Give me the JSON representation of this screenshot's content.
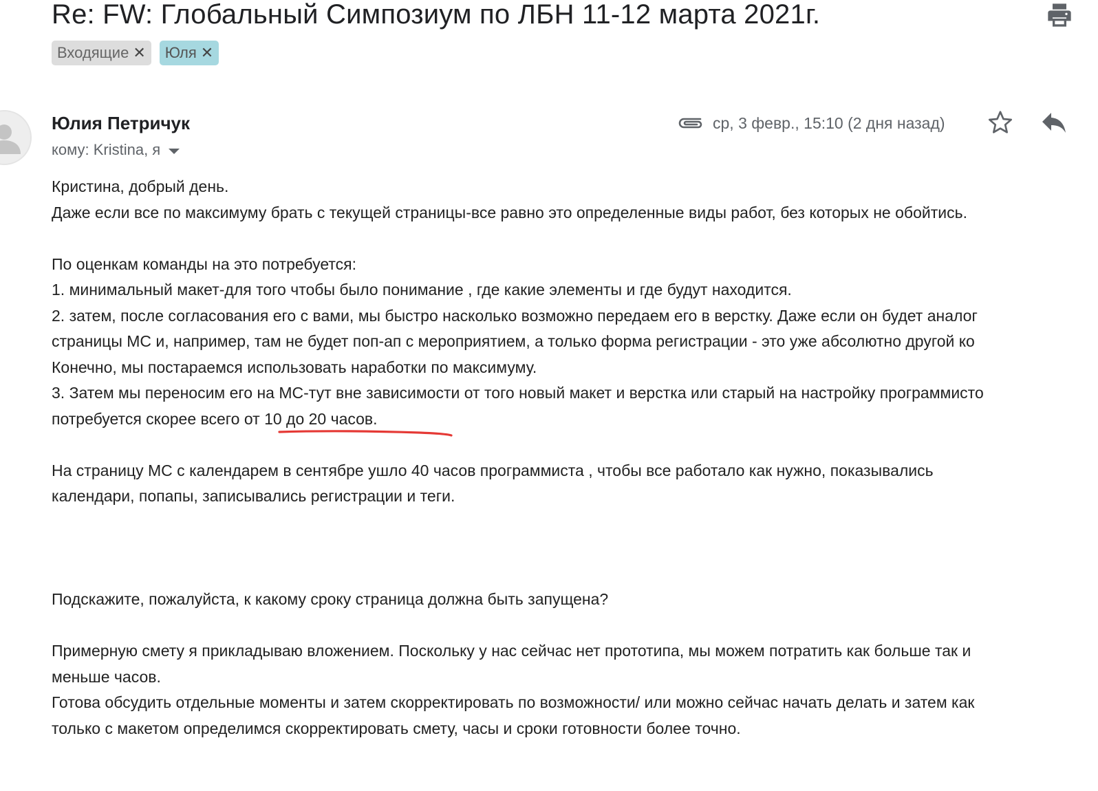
{
  "email": {
    "subject": "Re: FW: Глобальный Симпозиум по ЛБН 11-12 марта 2021г.",
    "labels": [
      {
        "name": "Входящие",
        "color": "#dddddd"
      },
      {
        "name": "Юля",
        "color": "#a6d8e0"
      }
    ],
    "sender": "Юлия Петричук",
    "recipients": "кому: Kristina, я",
    "date": "ср, 3 февр., 15:10 (2 дня назад)",
    "has_attachment": true,
    "body_lines": [
      "Кристина, добрый день.",
      "Даже если все по максимуму брать с текущей страницы-все равно это определенные виды работ, без которых не обойтись.",
      "",
      "По оценкам команды на это потребуется:",
      "1. минимальный макет-для того чтобы было понимание , где какие элементы и где будут находится.",
      "2. затем, после согласования его с вами, мы быстро насколько возможно передаем его в верстку. Даже если он будет аналог",
      "страницы МС и,  например, там не будет поп-ап с мероприятием, а только форма регистрации - это уже абсолютно другой ко",
      "Конечно, мы постараемся использовать наработки  по максимуму.",
      "3. Затем мы переносим его на МС-тут вне зависимости от того новый макет и верстка или старый на настройку программисто",
      "потребуется скорее всего  от 10 до  20 часов.",
      "",
      "На страницу МС с календарем в сентябре ушло 40 часов программиста , чтобы все работало как нужно, показывались",
      "календари, попапы, записывались регистрации и теги.",
      "",
      "",
      "",
      "Подскажите, пожалуйста, к какому сроку страница должна быть запущена?",
      "",
      "Примерную смету я прикладываю вложением. Поскольку у нас сейчас нет прототипа,  мы можем потратить как больше так и",
      "меньше часов.",
      "Готова обсудить отдельные моменты и затем скорректировать по возможности/ или можно сейчас начать делать и затем как",
      "только с макетом определимся скорректировать смету, часы и сроки готовности более точно."
    ]
  },
  "icons": {
    "print": "print-icon",
    "attachment": "paperclip-icon",
    "star": "star-icon",
    "reply": "reply-icon",
    "label_close": "close-icon",
    "recipients_expand": "chevron-down-icon",
    "avatar": "avatar-icon"
  },
  "annotation": {
    "type": "hand-drawn underline",
    "color": "#e53935",
    "target_text": "от 10 до  20 часов."
  }
}
